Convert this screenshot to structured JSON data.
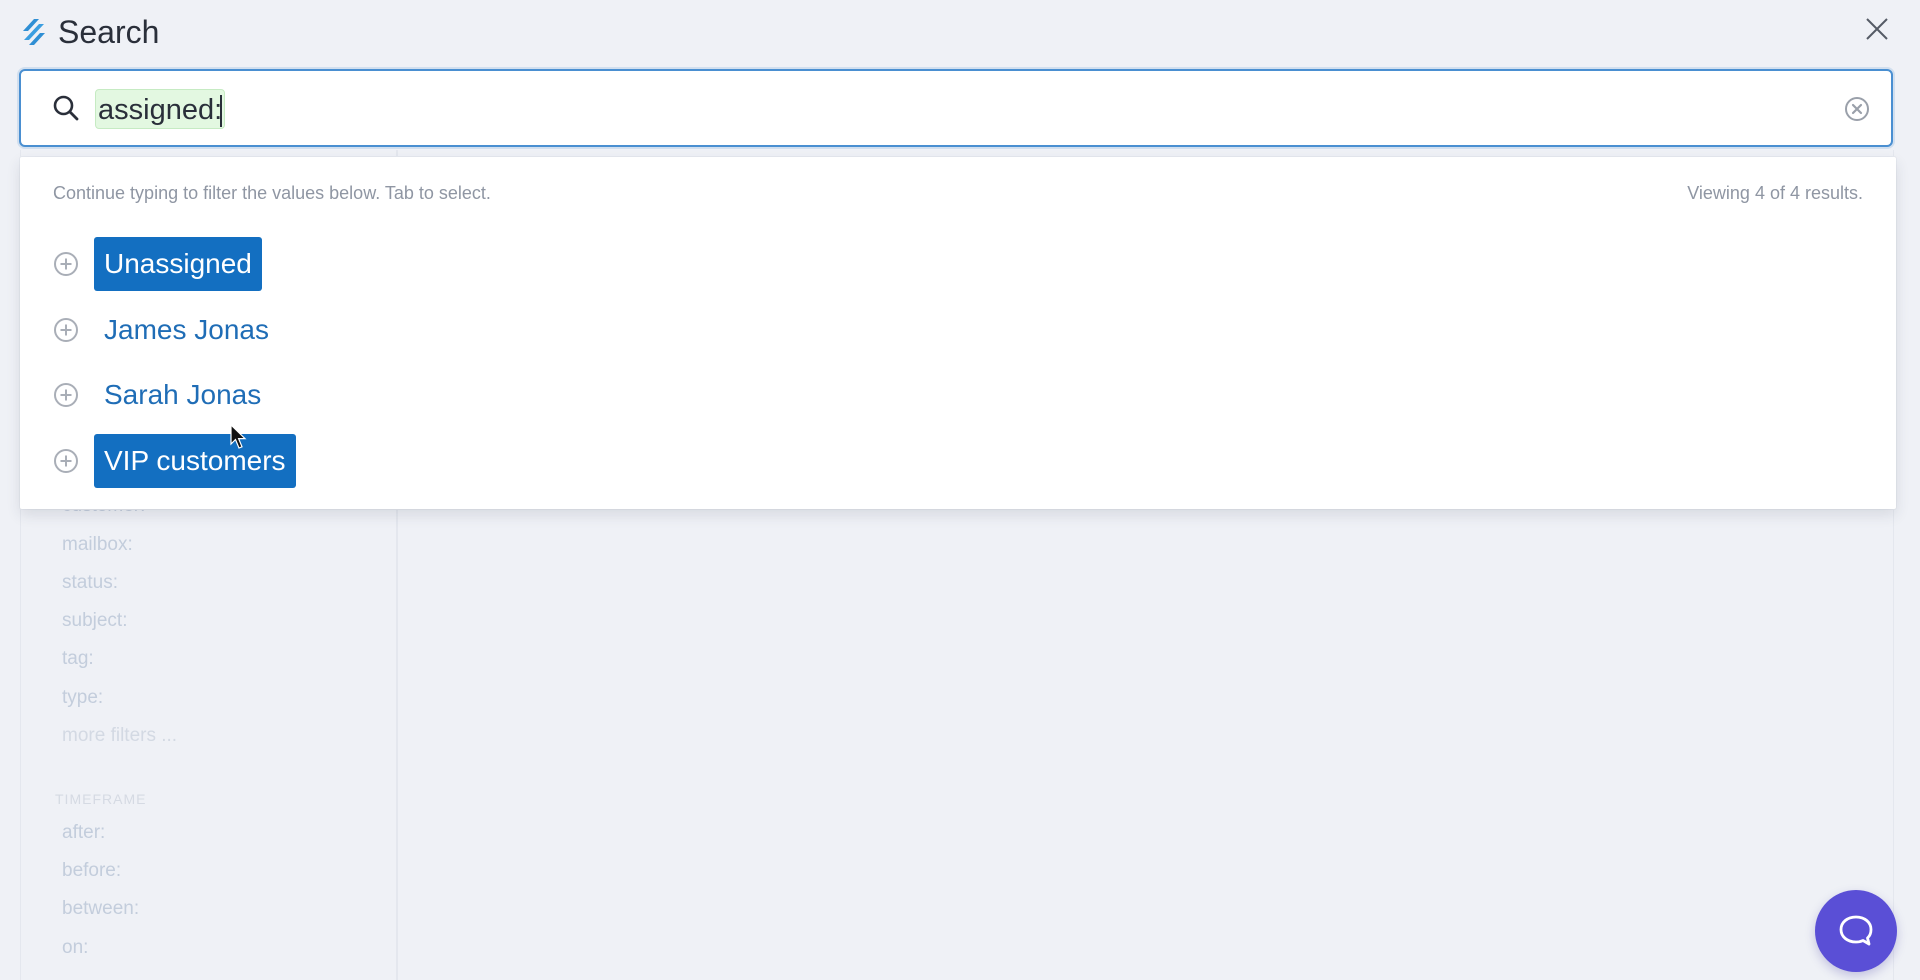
{
  "header": {
    "title": "Search",
    "brand_color": "#2f8fd4"
  },
  "search": {
    "query": "assigned:",
    "placeholder": ""
  },
  "dropdown": {
    "hint": "Continue typing to filter the values below. Tab to select.",
    "count": "Viewing 4 of 4 results.",
    "results": [
      {
        "label": "Unassigned",
        "highlighted": true
      },
      {
        "label": "James Jonas",
        "highlighted": false
      },
      {
        "label": "Sarah Jonas",
        "highlighted": false
      },
      {
        "label": "VIP customers",
        "highlighted": true
      }
    ]
  },
  "sidebar": {
    "filters": [
      {
        "label": "customer:"
      },
      {
        "label": "mailbox:"
      },
      {
        "label": "status:"
      },
      {
        "label": "subject:"
      },
      {
        "label": "tag:"
      },
      {
        "label": "type:"
      },
      {
        "label": "more filters ..."
      }
    ],
    "timeframe": {
      "title": "TIMEFRAME",
      "items": [
        {
          "label": "after:"
        },
        {
          "label": "before:"
        },
        {
          "label": "between:"
        },
        {
          "label": "on:"
        }
      ]
    }
  },
  "colors": {
    "accent": "#136fc1",
    "link": "#1f6db6",
    "token_bg": "#e3f8e1",
    "chat_button": "#5a4fd6"
  },
  "icons": {
    "logo": "helpscout-logo-icon",
    "close": "close-icon",
    "search": "search-icon",
    "clear": "clear-circle-x-icon",
    "add": "plus-circle-icon",
    "chat": "chat-bubble-icon"
  }
}
